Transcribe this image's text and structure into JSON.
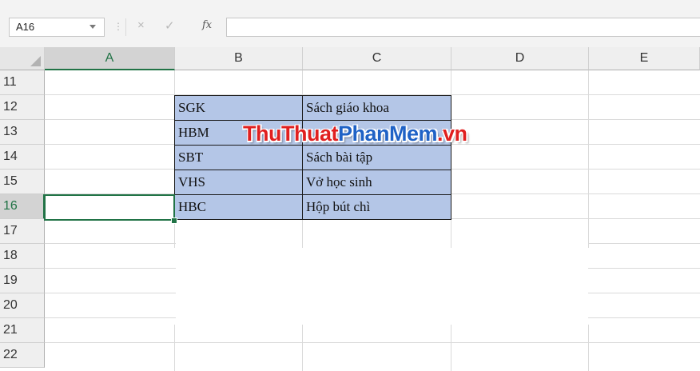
{
  "formula_bar": {
    "name_box": "A16",
    "cancel_icon": "×",
    "enter_icon": "✓",
    "function_icon": "fx",
    "formula_value": ""
  },
  "columns": [
    "A",
    "B",
    "C",
    "D",
    "E"
  ],
  "rows": [
    "11",
    "12",
    "13",
    "14",
    "15",
    "16",
    "17",
    "18",
    "19",
    "20",
    "21",
    "22"
  ],
  "cells": {
    "B12": "SGK",
    "C12": "Sách giáo khoa",
    "B13": "HBM",
    "C13": "",
    "B14": "SBT",
    "C14": "Sách bài tập",
    "B15": "VHS",
    "C15": "Vở học sinh",
    "B16": "HBC",
    "C16": "Hộp bút chì"
  },
  "active_cell": "A16",
  "watermark": {
    "part1": "ThuThuat",
    "part2": "PhanMem",
    "part3": ".vn"
  },
  "colors": {
    "table_fill": "#b4c6e7",
    "selection": "#217346",
    "wm_red": "#e02020",
    "wm_blue": "#1f62c6"
  }
}
